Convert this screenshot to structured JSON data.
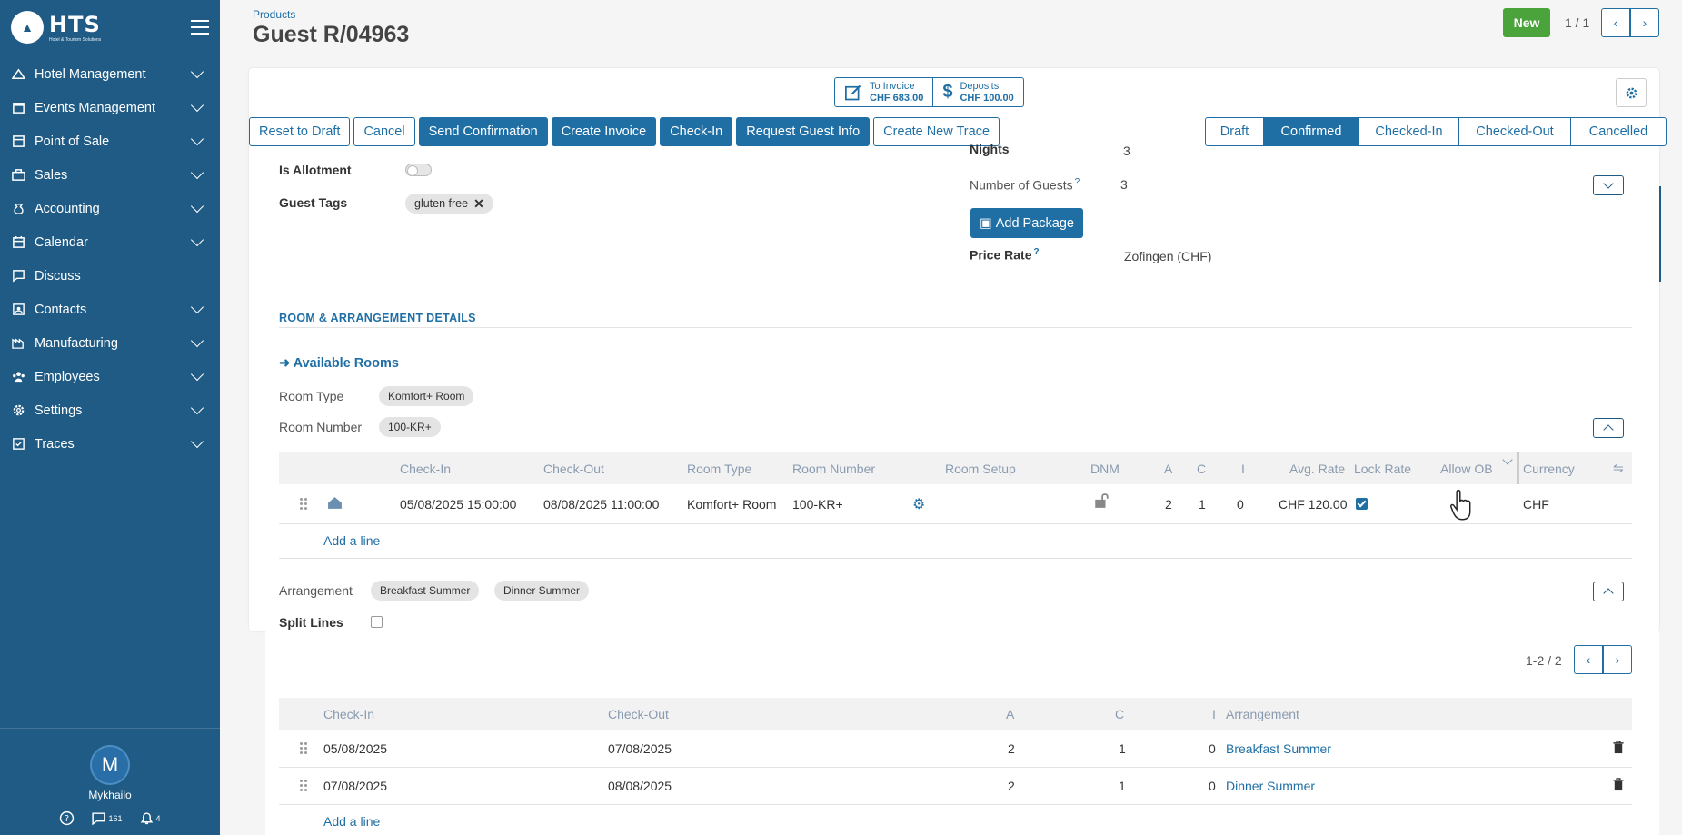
{
  "sidebar": {
    "logo_text": "HTS",
    "logo_sub": "Hotel & Tourism Solutions",
    "items": [
      {
        "label": "Hotel Management",
        "icon": "hotel-icon"
      },
      {
        "label": "Events Management",
        "icon": "events-icon"
      },
      {
        "label": "Point of Sale",
        "icon": "pos-icon"
      },
      {
        "label": "Sales",
        "icon": "sales-icon"
      },
      {
        "label": "Accounting",
        "icon": "accounting-icon"
      },
      {
        "label": "Calendar",
        "icon": "calendar-icon"
      },
      {
        "label": "Discuss",
        "icon": "discuss-icon"
      },
      {
        "label": "Contacts",
        "icon": "contacts-icon"
      },
      {
        "label": "Manufacturing",
        "icon": "manufacturing-icon"
      },
      {
        "label": "Employees",
        "icon": "employees-icon"
      },
      {
        "label": "Settings",
        "icon": "settings-icon"
      },
      {
        "label": "Traces",
        "icon": "traces-icon"
      }
    ],
    "user": {
      "initial": "M",
      "name": "Mykhailo"
    },
    "messages_count": "161",
    "notifications_count": "4"
  },
  "header": {
    "breadcrumb": "Products",
    "title": "Guest R/04963",
    "new_label": "New",
    "pager": "1 / 1"
  },
  "stats": {
    "to_invoice_label": "To Invoice",
    "to_invoice_value": "CHF 683.00",
    "deposits_label": "Deposits",
    "deposits_value": "CHF 100.00"
  },
  "actions": [
    "Reset to Draft",
    "Cancel",
    "Send Confirmation",
    "Create Invoice",
    "Check-In",
    "Request Guest Info",
    "Create New Trace"
  ],
  "statuses": [
    "Draft",
    "Confirmed",
    "Checked-In",
    "Checked-Out",
    "Cancelled"
  ],
  "active_status": "Confirmed",
  "form": {
    "is_allotment_label": "Is Allotment",
    "guest_tags_label": "Guest Tags",
    "guest_tag": "gluten free",
    "nights_label": "Nights",
    "nights_value": "3",
    "guests_label": "Number of Guests",
    "guests_value": "3",
    "add_package_label": "Add Package",
    "price_rate_label": "Price Rate",
    "price_rate_value": "Zofingen (CHF)",
    "help_mark": "?"
  },
  "room_section": {
    "title": "ROOM & ARRANGEMENT DETAILS",
    "available_rooms": "Available Rooms",
    "room_type_label": "Room Type",
    "room_type_value": "Komfort+ Room",
    "room_number_label": "Room Number",
    "room_number_value": "100-KR+",
    "columns": [
      "Check-In",
      "Check-Out",
      "Room Type",
      "Room Number",
      "Room Setup",
      "DNM",
      "A",
      "C",
      "I",
      "Avg. Rate",
      "Lock Rate",
      "Allow OB",
      "Currency"
    ],
    "row": {
      "check_in": "05/08/2025 15:00:00",
      "check_out": "08/08/2025 11:00:00",
      "room_type": "Komfort+ Room",
      "room_number": "100-KR+",
      "a": "2",
      "c": "1",
      "i": "0",
      "avg_rate": "CHF 120.00",
      "currency": "CHF"
    },
    "add_line": "Add a line",
    "arrangement_label": "Arrangement",
    "arrangements": [
      "Breakfast Summer",
      "Dinner Summer"
    ],
    "split_lines_label": "Split Lines"
  },
  "arrangement_table": {
    "pager": "1-2 / 2",
    "columns": [
      "Check-In",
      "Check-Out",
      "A",
      "C",
      "I",
      "Arrangement"
    ],
    "rows": [
      {
        "check_in": "05/08/2025",
        "check_out": "07/08/2025",
        "a": "2",
        "c": "1",
        "i": "0",
        "arrangement": "Breakfast Summer"
      },
      {
        "check_in": "07/08/2025",
        "check_out": "08/08/2025",
        "a": "2",
        "c": "1",
        "i": "0",
        "arrangement": "Dinner Summer"
      }
    ],
    "add_line": "Add a line"
  },
  "colors": {
    "sidebar": "#1f5b85",
    "primary": "#1f6fa5",
    "new_button": "#4ba33b"
  }
}
